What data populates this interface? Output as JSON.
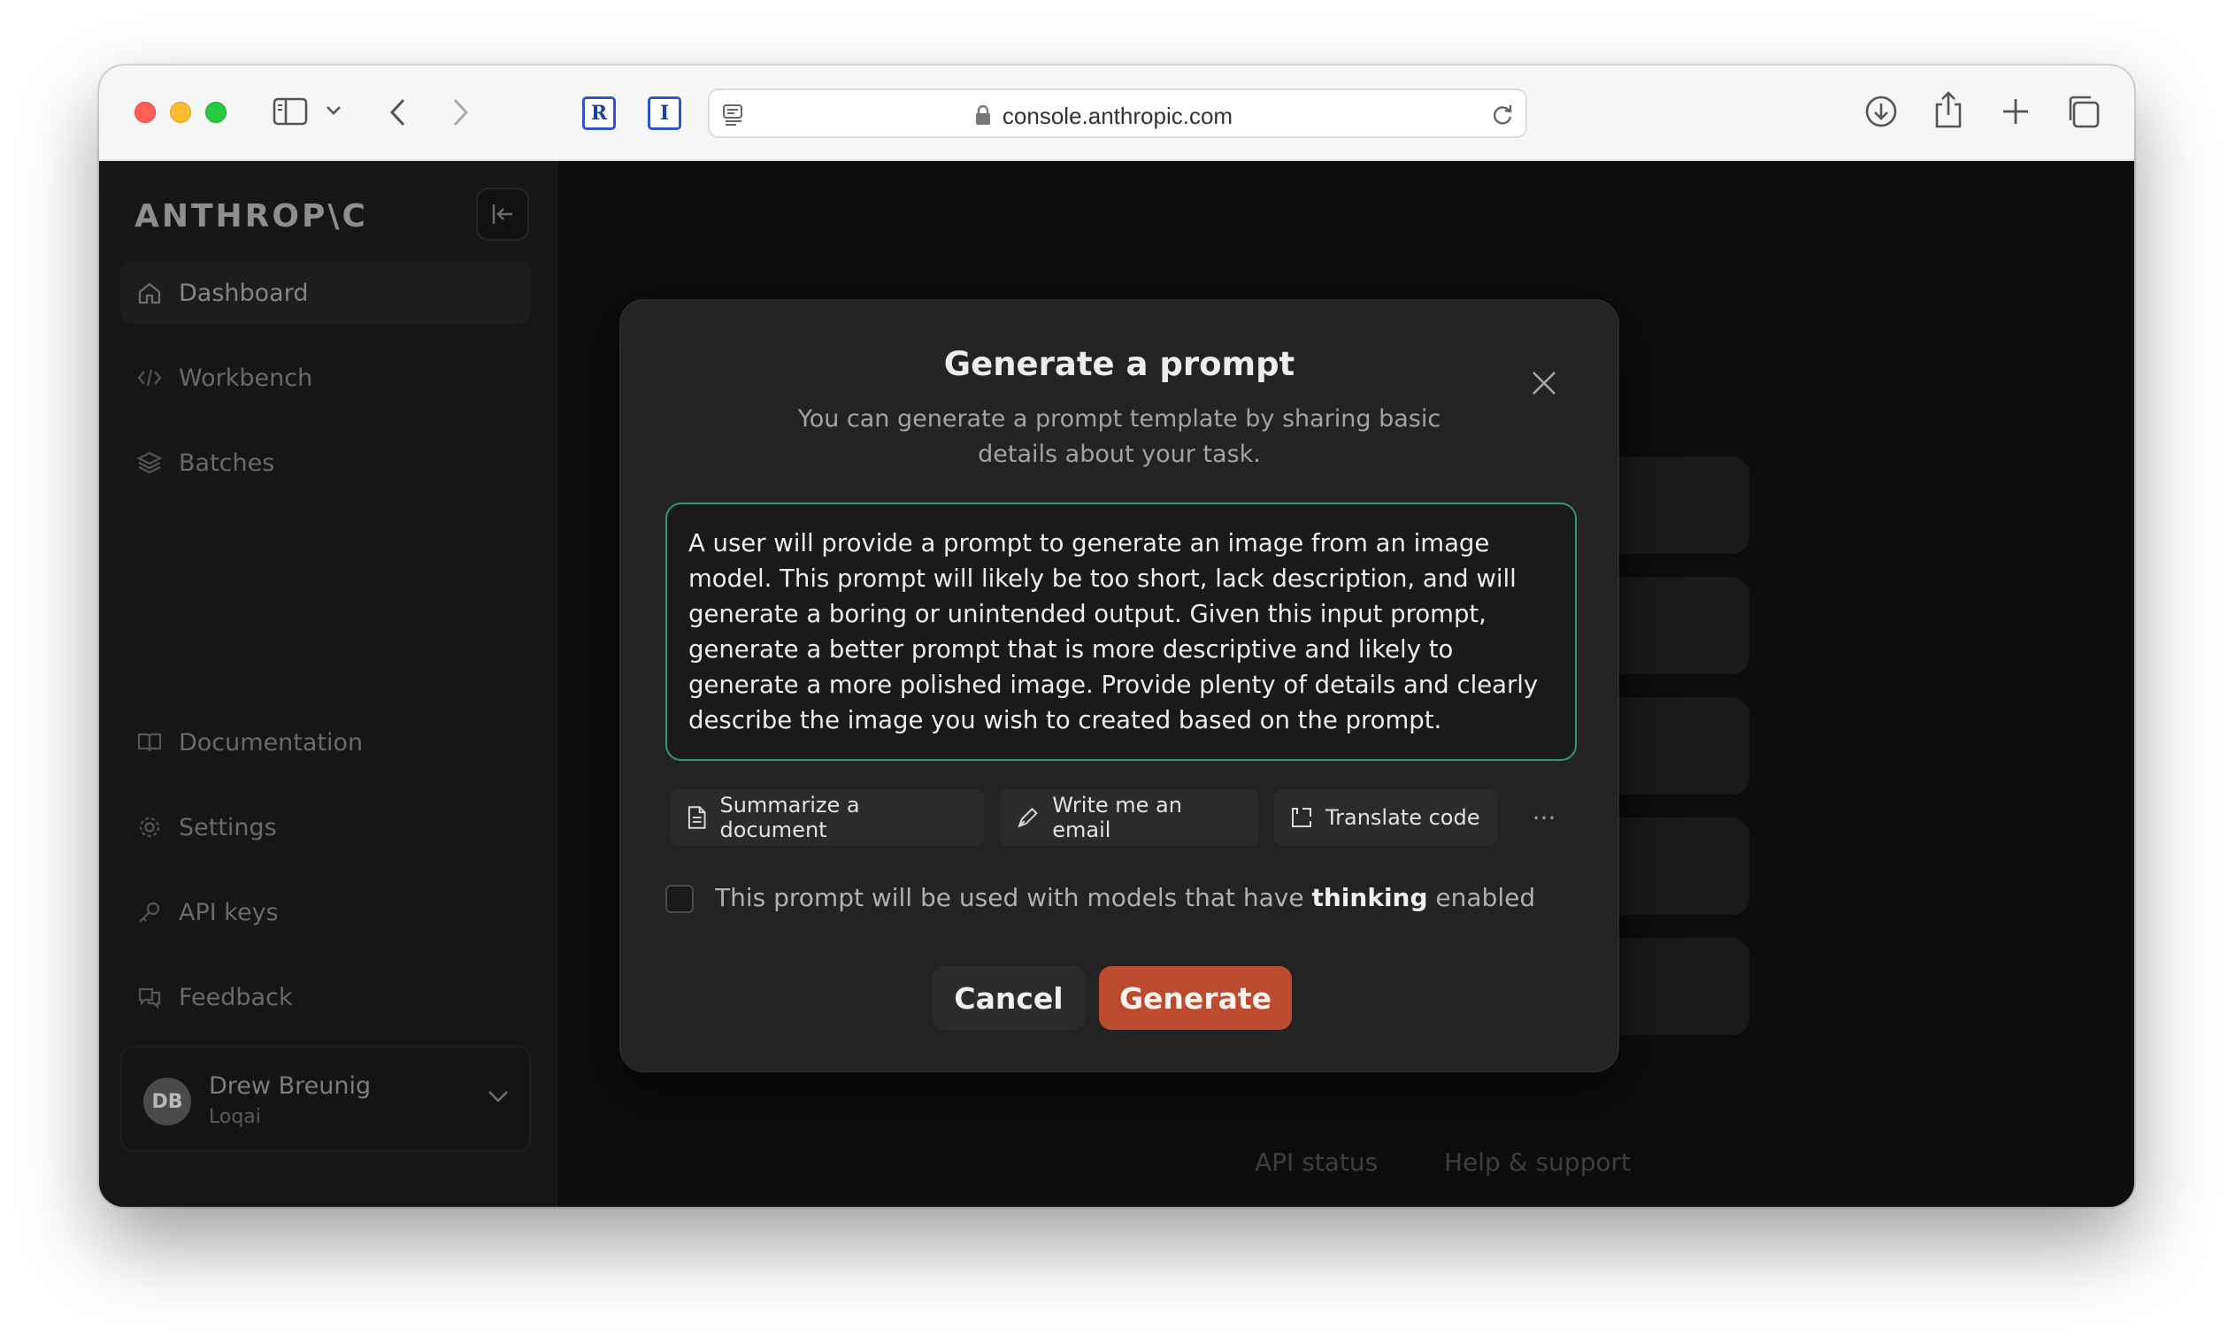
{
  "browser": {
    "url": "console.anthropic.com",
    "extensions": [
      "R",
      "I"
    ]
  },
  "sidebar": {
    "logo": "ANTHROP\\C",
    "nav_top": [
      {
        "label": "Dashboard",
        "icon": "home-icon",
        "active": true
      },
      {
        "label": "Workbench",
        "icon": "code-icon"
      },
      {
        "label": "Batches",
        "icon": "layers-icon"
      }
    ],
    "nav_bottom": [
      {
        "label": "Documentation",
        "icon": "book-icon"
      },
      {
        "label": "Settings",
        "icon": "gear-icon"
      },
      {
        "label": "API keys",
        "icon": "key-icon"
      },
      {
        "label": "Feedback",
        "icon": "feedback-icon"
      }
    ],
    "user": {
      "initials": "DB",
      "name": "Drew Breunig",
      "org": "Loqai"
    }
  },
  "main": {
    "footer_links": [
      "API status",
      "Help & support"
    ]
  },
  "modal": {
    "title": "Generate a prompt",
    "subtitle": "You can generate a prompt template by sharing basic details about your task.",
    "prompt_value": "A user will provide a prompt to generate an image from an image model. This prompt will likely be too short, lack description, and will generate a boring or unintended output. Given this input prompt, generate a better prompt that is more descriptive and likely to generate a more polished image. Provide plenty of details and clearly describe the image you wish to created based on the prompt.",
    "chips": [
      {
        "label": "Summarize a document",
        "icon": "document-icon"
      },
      {
        "label": "Write me an email",
        "icon": "pen-icon"
      },
      {
        "label": "Translate code",
        "icon": "translate-code-icon"
      }
    ],
    "more_label": "···",
    "thinking_checkbox": {
      "prefix": "This prompt will be used with models that have ",
      "bold": "thinking",
      "suffix": " enabled",
      "checked": false
    },
    "cancel_label": "Cancel",
    "generate_label": "Generate",
    "accent_color": "#bb4a2e",
    "focus_color": "#2f9a72"
  }
}
